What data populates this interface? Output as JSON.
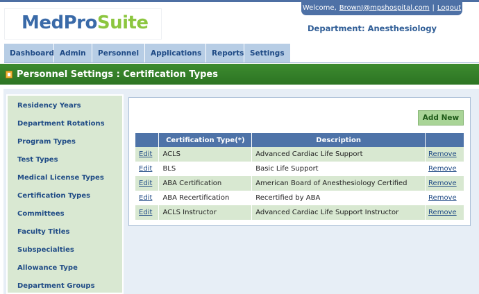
{
  "brand": {
    "part1": "MedPro",
    "part2": "Suite"
  },
  "header": {
    "welcome_prefix": "Welcome,",
    "user_email": "BrownJ@mpshospital.com",
    "separator": "|",
    "logout": "Logout",
    "department": "Department: Anesthesiology"
  },
  "nav": {
    "tabs": [
      {
        "label": "Dashboard"
      },
      {
        "label": "Admin"
      },
      {
        "label": "Personnel"
      },
      {
        "label": "Applications"
      },
      {
        "label": "Reports"
      },
      {
        "label": "Settings"
      }
    ]
  },
  "page": {
    "title": "Personnel Settings : Certification Types",
    "icon": "document-icon"
  },
  "sidebar": {
    "items": [
      {
        "label": "Residency Years"
      },
      {
        "label": "Department Rotations"
      },
      {
        "label": "Program Types"
      },
      {
        "label": "Test Types"
      },
      {
        "label": "Medical License Types"
      },
      {
        "label": "Certification Types"
      },
      {
        "label": "Committees"
      },
      {
        "label": "Faculty Titles"
      },
      {
        "label": "Subspecialties"
      },
      {
        "label": "Allowance Type"
      },
      {
        "label": "Department Groups"
      }
    ]
  },
  "main": {
    "add_new_label": "Add New",
    "table": {
      "columns": [
        "",
        "Certification Type(*)",
        "Description",
        ""
      ],
      "edit_label": "Edit",
      "remove_label": "Remove",
      "rows": [
        {
          "type": "ACLS",
          "description": "Advanced Cardiac Life Support"
        },
        {
          "type": "BLS",
          "description": "Basic Life Support"
        },
        {
          "type": "ABA Certification",
          "description": "American Board of Anesthesiology Certified"
        },
        {
          "type": "ABA Recertification",
          "description": "Recertified by ABA"
        },
        {
          "type": "ACLS Instructor",
          "description": "Advanced Cardiac Life Support Instructor"
        }
      ]
    }
  },
  "colors": {
    "header_blue": "#4e71a6",
    "tab_blue": "#b7cde5",
    "title_green": "#2c7423",
    "row_green": "#d8e8d1",
    "accent_green": "#8cc63f"
  }
}
